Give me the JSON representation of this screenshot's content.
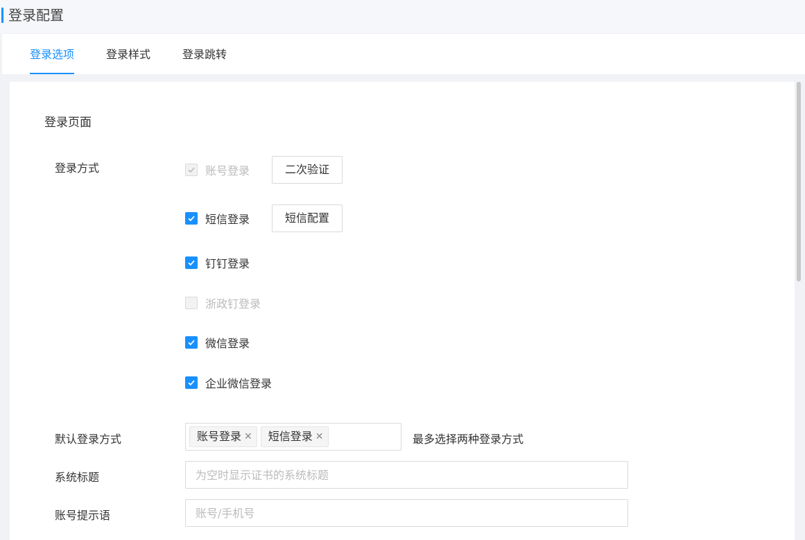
{
  "header": {
    "title": "登录配置"
  },
  "tabs": [
    {
      "label": "登录选项",
      "active": true
    },
    {
      "label": "登录样式",
      "active": false
    },
    {
      "label": "登录跳转",
      "active": false
    }
  ],
  "section": {
    "title": "登录页面"
  },
  "login_methods": {
    "label": "登录方式",
    "options": [
      {
        "label": "账号登录",
        "checked": true,
        "disabled": true,
        "button": "二次验证"
      },
      {
        "label": "短信登录",
        "checked": true,
        "disabled": false,
        "button": "短信配置"
      },
      {
        "label": "钉钉登录",
        "checked": true,
        "disabled": false
      },
      {
        "label": "浙政钉登录",
        "checked": false,
        "disabled": true
      },
      {
        "label": "微信登录",
        "checked": true,
        "disabled": false
      },
      {
        "label": "企业微信登录",
        "checked": true,
        "disabled": false
      }
    ]
  },
  "default_login": {
    "label": "默认登录方式",
    "selected": [
      "账号登录",
      "短信登录"
    ],
    "hint": "最多选择两种登录方式"
  },
  "system_title": {
    "label": "系统标题",
    "value": "",
    "placeholder": "为空时显示证书的系统标题"
  },
  "account_hint": {
    "label": "账号提示语",
    "value": "",
    "placeholder": "账号/手机号"
  },
  "colors": {
    "accent": "#1890ff",
    "disabled": "#bbbbbb"
  },
  "icons": {
    "check": "check-icon",
    "tag_close": "close-icon"
  }
}
